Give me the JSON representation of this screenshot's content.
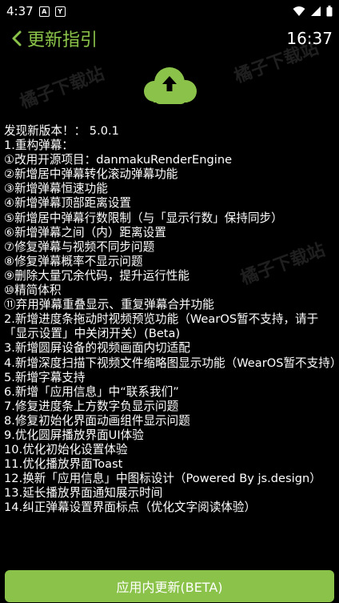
{
  "status_bar": {
    "time": "4:37",
    "icons": [
      "a-box-icon",
      "y-box-icon",
      "wifi-icon",
      "signal-icon",
      "battery-icon"
    ],
    "badge_a": "A",
    "badge_y": "Y"
  },
  "header": {
    "back_icon": "chevron-left-icon",
    "title": "更新指引",
    "clock": "16:37",
    "accent_color": "#8BC34A"
  },
  "hero": {
    "icon": "cloud-upload-icon"
  },
  "watermarks": [
    "橘子下载站",
    "橘子下载站",
    "橘子下载站"
  ],
  "changelog": {
    "lines": [
      "发现新版本！： 5.0.1",
      "1.重构弹幕：",
      "①改用开源项目：danmakuRenderEngine",
      "②新增居中弹幕转化滚动弹幕功能",
      "③新增弹幕恒速功能",
      "④新增弹幕顶部距离设置",
      "⑤新增居中弹幕行数限制（与「显示行数」保持同步）",
      "⑥新增弹幕之间（内）距离设置",
      "⑦修复弹幕与视频不同步问题",
      "⑧修复弹幕概率不显示问题",
      "⑨删除大量冗余代码，提升运行性能",
      "⑩精简体积",
      "⑪弃用弹幕重叠显示、重复弹幕合并功能",
      "2.新增进度条拖动时视频预览功能（WearOS暂不支持，请于「显示设置」中关闭开关）(Beta)",
      "3.新增圆屏设备的视频画面内切适配",
      "4.新增深度扫描下视频文件缩略图显示功能（WearOS暂不支持）",
      "5.新增字幕支持",
      "6.新增「应用信息」中“联系我们”",
      "7.修复进度条上方数字负显示问题",
      "8.修复初始化界面动画组件显示问题",
      "9.优化圆屏播放界面UI体验",
      "10.优化初始化设置体验",
      "11.优化播放界面Toast",
      "12.换新「应用信息」中图标设计（Powered By js.design）",
      "13.延长播放界面通知展示时间",
      "14.纠正弹幕设置界面标点（优化文字阅读体验）"
    ]
  },
  "footer": {
    "update_button": "应用内更新(BETA)"
  }
}
